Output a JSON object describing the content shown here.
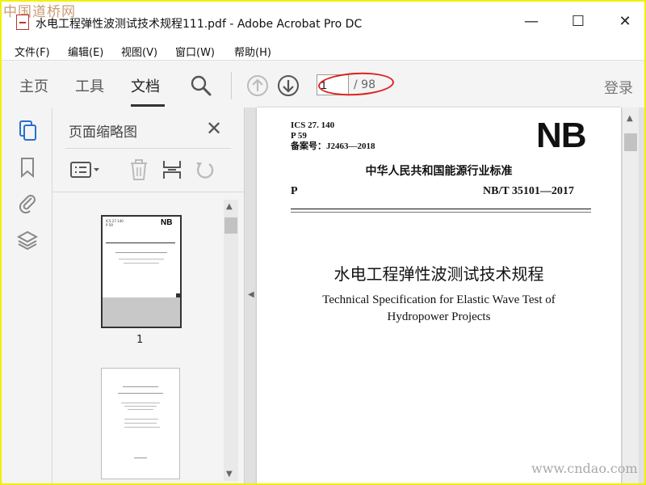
{
  "window": {
    "title": "水电工程弹性波测试技术规程111.pdf - Adobe Acrobat Pro DC",
    "minimize": "—",
    "maximize": "☐",
    "close": "✕"
  },
  "watermarks": {
    "top_left": "中国道桥网",
    "bottom_right": "www.cndao.com"
  },
  "menu": [
    "文件(F)",
    "编辑(E)",
    "视图(V)",
    "窗口(W)",
    "帮助(H)"
  ],
  "toolbar": {
    "tabs": [
      "主页",
      "工具",
      "文档"
    ],
    "active_tab": "文档",
    "current_page": "1",
    "total_pages": "/ 98",
    "login": "登录",
    "icons": [
      "search-icon",
      "arrow-up-icon",
      "arrow-down-icon"
    ]
  },
  "left_rail": {
    "icons": [
      "page-thumbnails-icon",
      "bookmark-icon",
      "attachment-icon",
      "layers-icon"
    ]
  },
  "thumb_panel": {
    "title": "页面缩略图",
    "close": "✕",
    "tools": [
      "options-icon",
      "delete-icon",
      "extract-icon",
      "rotate-icon"
    ],
    "pages": [
      {
        "label": "1"
      }
    ]
  },
  "document": {
    "ics_lines": [
      "ICS 27. 140",
      "P 59",
      "备案号：J2463—2018"
    ],
    "logo": "NB",
    "org_standard": "中华人民共和国能源行业标准",
    "category": "P",
    "standard_no": "NB/T 35101—2017",
    "title_cn": "水电工程弹性波测试技术规程",
    "title_en_lines": [
      "Technical Specification for Elastic Wave Test of",
      "Hydropower Projects"
    ]
  },
  "colors": {
    "accent_blue": "#2a6fd1",
    "annotation_red": "#e02020",
    "frame_yellow": "#f0f000"
  }
}
